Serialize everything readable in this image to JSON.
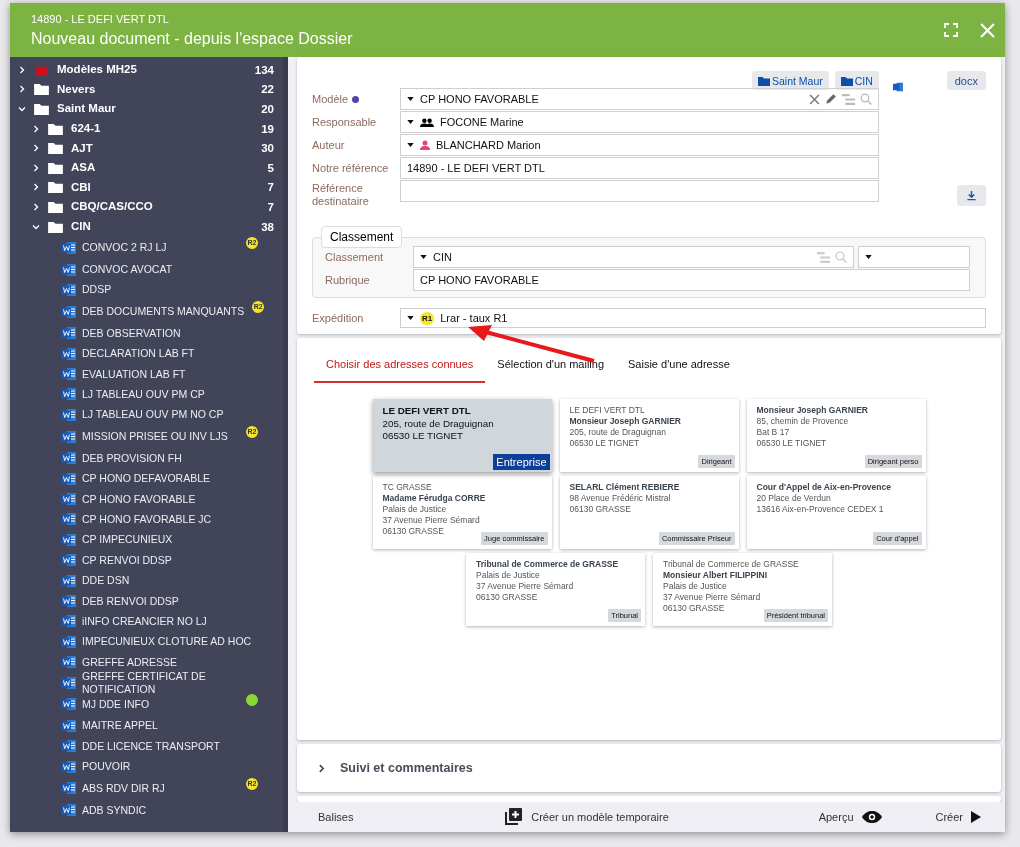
{
  "window": {
    "record": "14890 - LE DEFI VERT DTL",
    "title": "Nouveau document - depuis l'espace Dossier"
  },
  "sidebar": {
    "tree": [
      {
        "kind": "briefcase",
        "label": "Modèles MH25",
        "count": "134",
        "expanded": false
      },
      {
        "kind": "folder",
        "label": "Nevers",
        "count": "22",
        "expanded": false
      },
      {
        "kind": "folder",
        "label": "Saint Maur",
        "count": "20",
        "expanded": true,
        "children": [
          {
            "kind": "folder",
            "label": "624-1",
            "count": "19",
            "expanded": false
          },
          {
            "kind": "folder",
            "label": "AJT",
            "count": "30",
            "expanded": false
          },
          {
            "kind": "folder",
            "label": "ASA",
            "count": "5",
            "expanded": false
          },
          {
            "kind": "folder",
            "label": "CBI",
            "count": "7",
            "expanded": false
          },
          {
            "kind": "folder",
            "label": "CBQ/CAS/CCO",
            "count": "7",
            "expanded": false
          },
          {
            "kind": "folder",
            "label": "CIN",
            "count": "38",
            "expanded": true,
            "children": [
              {
                "kind": "document",
                "label": "CONVOC 2 RJ LJ",
                "badge": {
                  "label": "R2",
                  "color": "#f5e52a"
                }
              },
              {
                "kind": "document",
                "label": "CONVOC AVOCAT"
              },
              {
                "kind": "document",
                "label": "DDSP"
              },
              {
                "kind": "document",
                "label": "DEB DOCUMENTS MANQUANTS",
                "badge": {
                  "label": "R2",
                  "color": "#f5e52a"
                }
              },
              {
                "kind": "document",
                "label": "DEB OBSERVATION"
              },
              {
                "kind": "document",
                "label": "DECLARATION LAB FT"
              },
              {
                "kind": "document",
                "label": "EVALUATION LAB FT"
              },
              {
                "kind": "document",
                "label": "LJ TABLEAU OUV PM CP"
              },
              {
                "kind": "document",
                "label": "LJ TABLEAU OUV PM NO CP"
              },
              {
                "kind": "document",
                "label": "MISSION PRISEE OU INV LJS",
                "badge": {
                  "label": "R2",
                  "color": "#f5e52a"
                }
              },
              {
                "kind": "document",
                "label": "DEB PROVISION FH"
              },
              {
                "kind": "document",
                "label": "CP HONO DEFAVORABLE"
              },
              {
                "kind": "document",
                "label": "CP HONO FAVORABLE"
              },
              {
                "kind": "document",
                "label": "CP HONO FAVORABLE JC"
              },
              {
                "kind": "document",
                "label": "CP IMPECUNIEUX"
              },
              {
                "kind": "document",
                "label": "CP RENVOI DDSP"
              },
              {
                "kind": "document",
                "label": "DDE DSN"
              },
              {
                "kind": "document",
                "label": "DEB RENVOI DDSP"
              },
              {
                "kind": "document",
                "label": "iINFO CREANCIER NO LJ"
              },
              {
                "kind": "document",
                "label": "IMPECUNIEUX CLOTURE AD HOC"
              },
              {
                "kind": "document",
                "label": "GREFFE ADRESSE"
              },
              {
                "kind": "document",
                "label": "GREFFE CERTIFICAT DE NOTIFICATION"
              },
              {
                "kind": "document",
                "label": "MJ DDE INFO",
                "badge": {
                  "color": "#8bd82e"
                }
              },
              {
                "kind": "document",
                "label": "MAITRE APPEL"
              },
              {
                "kind": "document",
                "label": "DDE LICENCE TRANSPORT"
              },
              {
                "kind": "document",
                "label": "POUVOIR"
              },
              {
                "kind": "document",
                "label": "ABS RDV DIR RJ",
                "badge": {
                  "label": "R2",
                  "color": "#f5e52a"
                }
              },
              {
                "kind": "document",
                "label": "ADB SYNDIC"
              }
            ]
          }
        ]
      }
    ]
  },
  "form": {
    "locations": [
      "Saint Maur",
      "CIN"
    ],
    "format": "docx",
    "fields": [
      {
        "kind": "model",
        "label": "Modèle",
        "value": "CP HONO FAVORABLE"
      },
      {
        "kind": "group",
        "label": "Responsable",
        "value": "FOCONE Marine"
      },
      {
        "kind": "person",
        "label": "Auteur",
        "value": "BLANCHARD Marion"
      },
      {
        "kind": "text",
        "label": "Notre référence",
        "value": "14890 - LE DEFI VERT DTL"
      },
      {
        "kind": "text",
        "label": "Référence destinataire"
      }
    ],
    "classement": {
      "legend": "Classement",
      "fields": [
        {
          "kind": "tree",
          "label": "Classement",
          "value": "CIN"
        },
        {
          "kind": "text",
          "label": "Rubrique",
          "value": "CP HONO FAVORABLE"
        }
      ]
    },
    "expedition": {
      "label": "Expédition",
      "badge": "R1",
      "value": "Lrar - taux R1"
    }
  },
  "tabs": [
    {
      "label": "Choisir des adresses connues",
      "selected": true
    },
    {
      "label": "Sélection d'un mailing",
      "selected": false
    },
    {
      "label": "Saisie d'une adresse",
      "selected": false
    }
  ],
  "addresses": [
    {
      "selected": true,
      "tag": "Entreprise",
      "lines": [
        {
          "text": "LE DEFI VERT DTL",
          "bold": true
        },
        {
          "text": "205, route de Draguignan",
          "bold": false
        },
        {
          "text": "06530 LE TIGNET",
          "bold": false
        }
      ]
    },
    {
      "selected": false,
      "tag": "Dirigeant",
      "lines": [
        {
          "text": "LE DEFI VERT DTL",
          "bold": false
        },
        {
          "text": "Monsieur Joseph GARNIER",
          "bold": true
        },
        {
          "text": "205, route de Draguignan",
          "bold": false
        },
        {
          "text": "06530 LE TIGNET",
          "bold": false
        }
      ]
    },
    {
      "selected": false,
      "tag": "Dirigeant perso",
      "lines": [
        {
          "text": "Monsieur Joseph GARNIER",
          "bold": true
        },
        {
          "text": "85, chemin de Provence",
          "bold": false
        },
        {
          "text": "Bat B 17",
          "bold": false
        },
        {
          "text": "06530 LE TIGNET",
          "bold": false
        }
      ]
    },
    {
      "selected": false,
      "tag": "Juge commissaire",
      "lines": [
        {
          "text": "TC GRASSE",
          "bold": false
        },
        {
          "text": "Madame Férudga CORRE",
          "bold": true
        },
        {
          "text": "Palais de Justice",
          "bold": false
        },
        {
          "text": "37 Avenue Pierre Sémard",
          "bold": false
        },
        {
          "text": "06130 GRASSE",
          "bold": false
        }
      ]
    },
    {
      "selected": false,
      "tag": "Commissaire Priseur",
      "lines": [
        {
          "text": "SELARL Clément REBIERE",
          "bold": true
        },
        {
          "text": "98 Avenue Frédéric Mistral",
          "bold": false
        },
        {
          "text": "06130 GRASSE",
          "bold": false
        }
      ]
    },
    {
      "selected": false,
      "tag": "Cour d'appel",
      "lines": [
        {
          "text": "Cour d'Appel de Aix-en-Provence",
          "bold": true
        },
        {
          "text": "20 Place de Verdun",
          "bold": false
        },
        {
          "text": "13616 Aix-en-Provence CEDEX 1",
          "bold": false
        }
      ]
    },
    {
      "selected": false,
      "tag": "Tribunal",
      "lines": [
        {
          "text": "Tribunal de Commerce de GRASSE",
          "bold": true
        },
        {
          "text": "Palais de Justice",
          "bold": false
        },
        {
          "text": "37 Avenue Pierre Sémard",
          "bold": false
        },
        {
          "text": "06130 GRASSE",
          "bold": false
        }
      ]
    },
    {
      "selected": false,
      "tag": "Président tribunal",
      "lines": [
        {
          "text": "Tribunal de Commerce de GRASSE",
          "bold": false
        },
        {
          "text": "Monsieur Albert FILIPPINI",
          "bold": true
        },
        {
          "text": "Palais de Justice",
          "bold": false
        },
        {
          "text": "37 Avenue Pierre Sémard",
          "bold": false
        },
        {
          "text": "06130 GRASSE",
          "bold": false
        }
      ]
    }
  ],
  "sections": [
    {
      "label": "Suivi et commentaires",
      "expanded": false
    }
  ],
  "footer": {
    "tags": "Balises",
    "temp_model": "Créer un modèle temporaire",
    "preview": "Aperçu",
    "create": "Créer"
  }
}
